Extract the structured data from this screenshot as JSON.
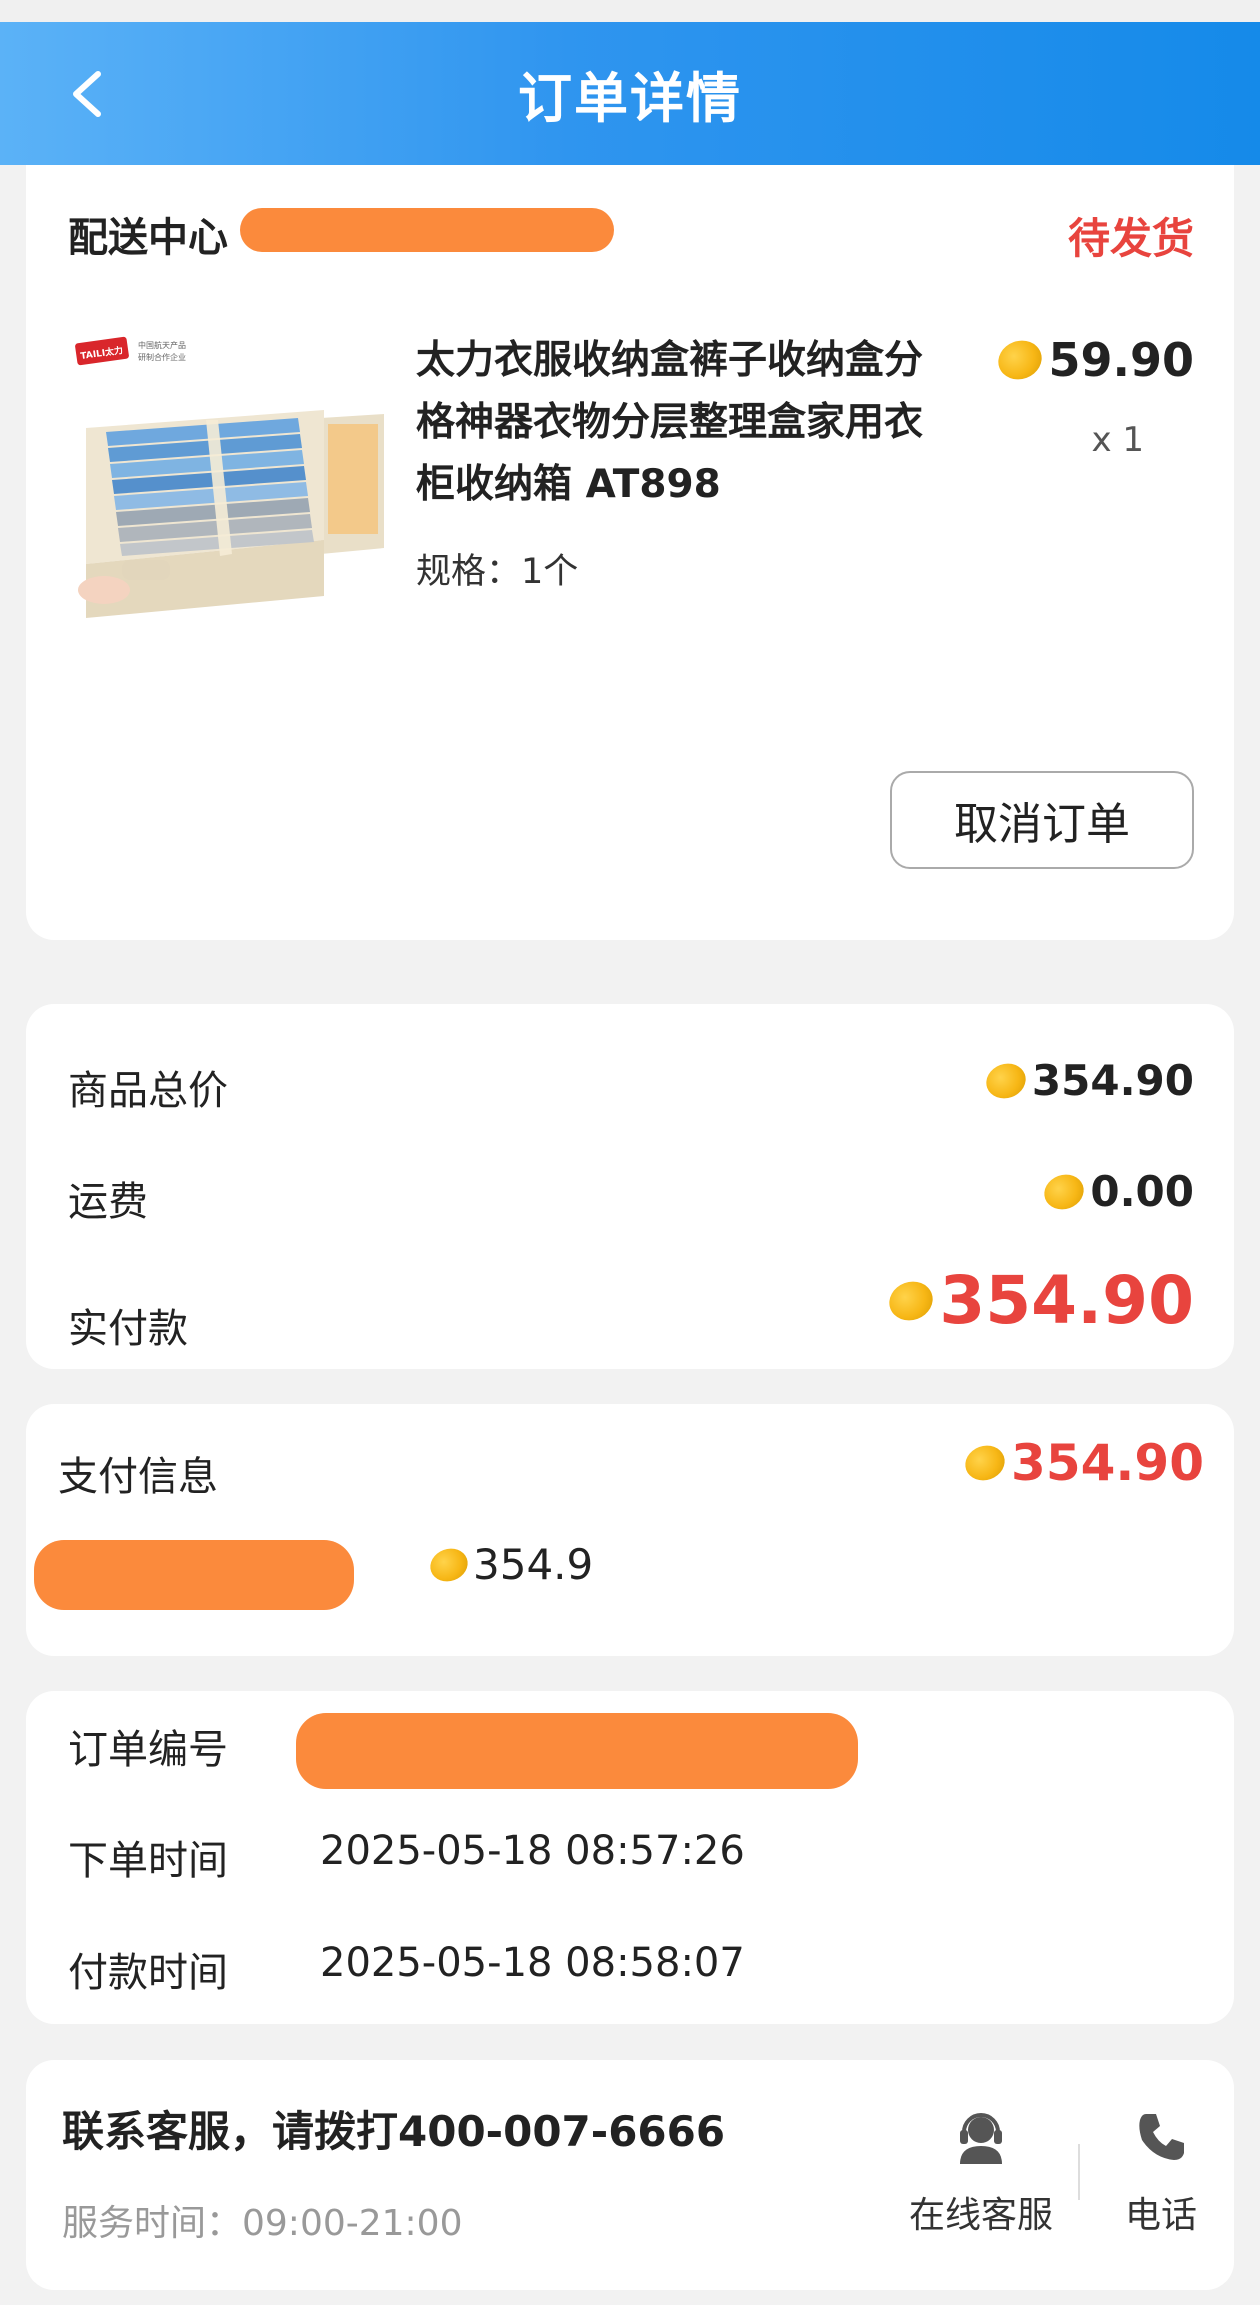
{
  "header": {
    "title": "订单详情",
    "back_icon": "chevron-left-icon"
  },
  "order": {
    "store_prefix": "配送中心",
    "status": "待发货",
    "product": {
      "title": "太力衣服收纳盒裤子收纳盒分格神器衣物分层整理盒家用衣柜收纳箱 AT898",
      "title_line1": "太力衣服收纳盒裤子收纳盒分",
      "title_line2": "格神器衣物分层整理盒家用衣",
      "title_line3": "柜收纳箱 AT898",
      "spec": "规格：1个",
      "price": "59.90",
      "qty": "x 1",
      "brand_logo_text": "TAILI太力",
      "brand_tagline_1": "中国航天产品",
      "brand_tagline_2": "研制合作企业"
    },
    "cancel_label": "取消订单"
  },
  "summary": {
    "goods_total_label": "商品总价",
    "goods_total": "354.90",
    "shipping_label": "运费",
    "shipping": "0.00",
    "paid_label": "实付款",
    "paid": "354.90"
  },
  "payment": {
    "title": "支付信息",
    "total": "354.90",
    "method_amount": "354.9"
  },
  "info": {
    "order_no_label": "订单编号",
    "created_label": "下单时间",
    "created": "2025-05-18 08:57:26",
    "paid_time_label": "付款时间",
    "paid_time": "2025-05-18 08:58:07"
  },
  "service": {
    "title": "联系客服，请拨打400-007-6666",
    "hours": "服务时间：09:00-21:00",
    "online_label": "在线客服",
    "phone_label": "电话"
  },
  "colors": {
    "header_start": "#5bb2f7",
    "header_end": "#158ae9",
    "accent_red": "#e8443e",
    "redaction": "#fb8a3c",
    "coin": "#f7b716"
  }
}
